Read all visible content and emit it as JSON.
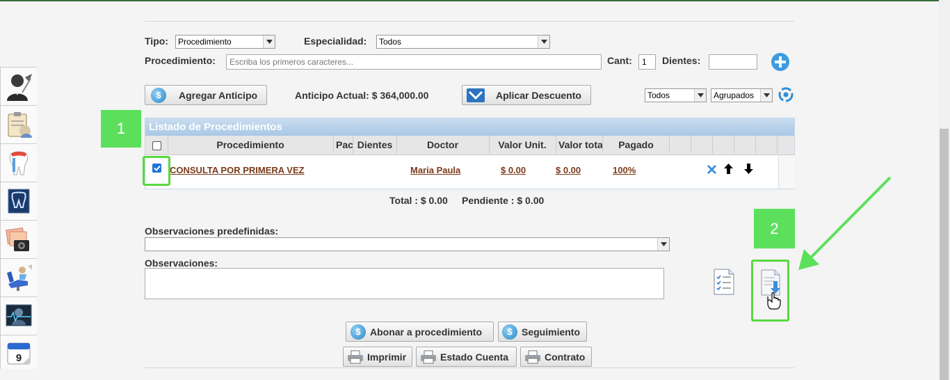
{
  "filters": {
    "tipo_label": "Tipo:",
    "tipo_value": "Procedimiento",
    "especialidad_label": "Especialidad:",
    "especialidad_value": "Todos",
    "procedimiento_label": "Procedimiento:",
    "procedimiento_placeholder": "Escriba los primeros caracteres...",
    "cant_label": "Cant:",
    "cant_value": "1",
    "dientes_label": "Dientes:",
    "dientes_value": ""
  },
  "actions": {
    "agregar_anticipo": "Agregar Anticipo",
    "anticipo_actual": "Anticipo Actual: $ 364,000.00",
    "aplicar_descuento": "Aplicar Descuento",
    "filter1_value": "Todos",
    "filter2_value": "Agrupados"
  },
  "table": {
    "title": "Listado de Procedimientos",
    "headers": [
      "Procedimiento",
      "Pac",
      "Dientes",
      "Doctor",
      "Valor Unit.",
      "Valor total",
      "Pagado"
    ],
    "rows": [
      {
        "procedimiento": "CONSULTA POR PRIMERA VEZ",
        "doctor": "Maria Paula",
        "valor_unit": "$ 0.00",
        "valor_total": "$ 0.00",
        "pagado": "100%"
      }
    ],
    "total": "Total : $ 0.00",
    "pendiente": "Pendiente : $ 0.00"
  },
  "observaciones": {
    "predefinidas_label": "Observaciones predefinidas:",
    "predefinidas_value": "",
    "label": "Observaciones:",
    "value": ""
  },
  "buttons": {
    "abonar": "Abonar a procedimiento",
    "seguimiento": "Seguimiento",
    "imprimir": "Imprimir",
    "estado_cuenta": "Estado Cuenta",
    "contrato": "Contrato"
  },
  "annotations": {
    "step1": "1",
    "step2": "2"
  },
  "sidebar": {
    "icons": [
      "doctor-icon",
      "clipboard-icon",
      "tooth-icon",
      "xray-icon",
      "photos-icon",
      "dental-chair-icon",
      "monitor-icon",
      "calendar-icon"
    ],
    "calendar_day": "9"
  },
  "colors": {
    "annotation_green": "#5ce05c",
    "table_header": "#b5d0ea",
    "link_brown": "#7a3a1a"
  }
}
